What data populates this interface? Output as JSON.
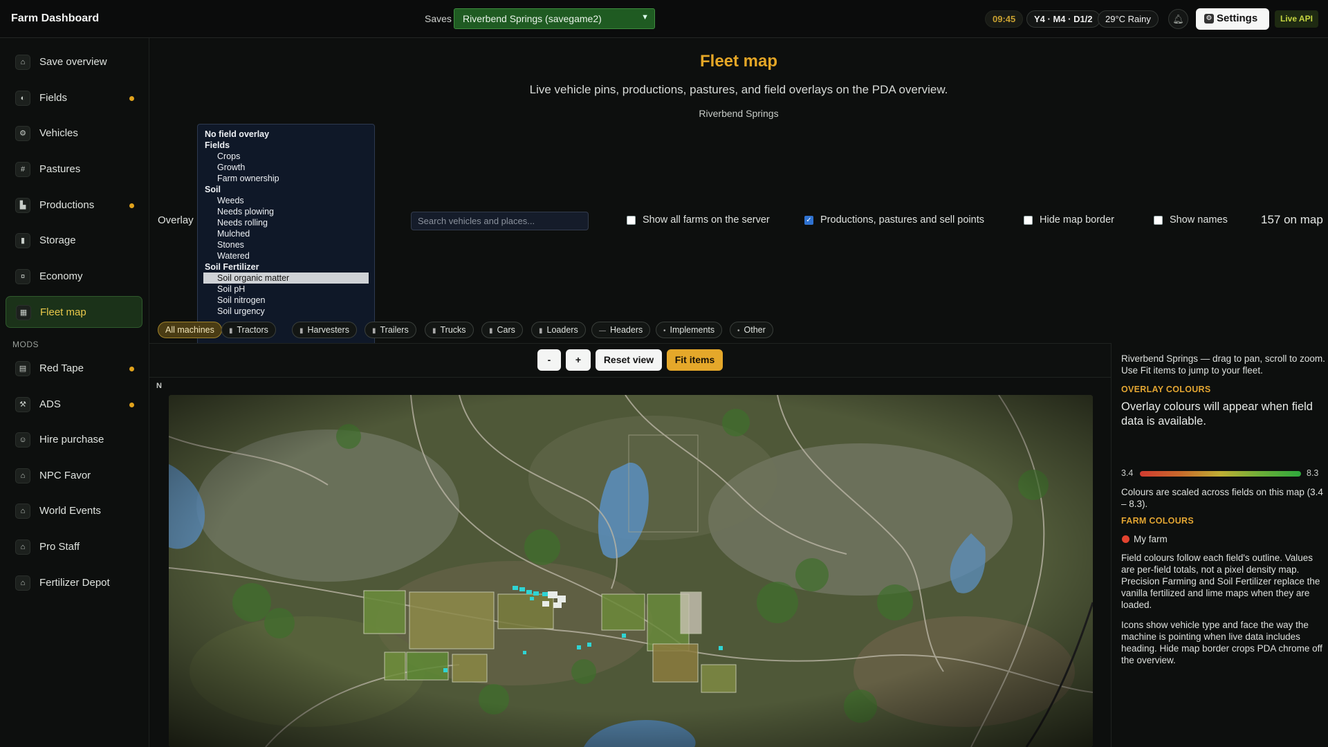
{
  "header": {
    "app_title": "Farm Dashboard",
    "saves_label": "Saves",
    "saves_selected": "Riverbend Springs (savegame2)",
    "time": "09:45",
    "date": "Y4 · M4 · D1/2",
    "weather": "29°C Rainy",
    "settings_label": "Settings",
    "live_api": "Live API"
  },
  "sidebar": {
    "items": [
      {
        "label": "Save overview",
        "icon": "home-icon",
        "dot": false
      },
      {
        "label": "Fields",
        "icon": "fields-icon",
        "dot": true
      },
      {
        "label": "Vehicles",
        "icon": "tractor-icon",
        "dot": false
      },
      {
        "label": "Pastures",
        "icon": "pasture-icon",
        "dot": false
      },
      {
        "label": "Productions",
        "icon": "factory-icon",
        "dot": true
      },
      {
        "label": "Storage",
        "icon": "silo-icon",
        "dot": false
      },
      {
        "label": "Economy",
        "icon": "coins-icon",
        "dot": false
      },
      {
        "label": "Fleet map",
        "icon": "map-icon",
        "dot": false,
        "active": true
      }
    ],
    "mods_label": "MODS",
    "mods": [
      {
        "label": "Red Tape",
        "icon": "clipboard-icon",
        "dot": true
      },
      {
        "label": "ADS",
        "icon": "wrench-icon",
        "dot": true
      },
      {
        "label": "Hire purchase",
        "icon": "person-icon",
        "dot": false
      },
      {
        "label": "NPC Favor",
        "icon": "npc-icon",
        "dot": false
      },
      {
        "label": "World Events",
        "icon": "globe-icon",
        "dot": false
      },
      {
        "label": "Pro Staff",
        "icon": "staff-icon",
        "dot": false
      },
      {
        "label": "Fertilizer Depot",
        "icon": "depot-icon",
        "dot": false
      }
    ]
  },
  "main": {
    "title": "Fleet map",
    "subtitle": "Live vehicle pins, productions, pastures, and field overlays on the PDA overview.",
    "save_name": "Riverbend Springs"
  },
  "controls": {
    "overlay_label": "Overlay",
    "overlay_options": [
      {
        "label": "No field overlay",
        "type": "grp"
      },
      {
        "label": "Fields",
        "type": "grp"
      },
      {
        "label": "Crops",
        "type": "sub"
      },
      {
        "label": "Growth",
        "type": "sub"
      },
      {
        "label": "Farm ownership",
        "type": "sub"
      },
      {
        "label": "Soil",
        "type": "grp"
      },
      {
        "label": "Weeds",
        "type": "sub"
      },
      {
        "label": "Needs plowing",
        "type": "sub"
      },
      {
        "label": "Needs rolling",
        "type": "sub"
      },
      {
        "label": "Mulched",
        "type": "sub"
      },
      {
        "label": "Stones",
        "type": "sub"
      },
      {
        "label": "Watered",
        "type": "sub"
      },
      {
        "label": "Soil Fertilizer",
        "type": "grp"
      },
      {
        "label": "Soil organic matter",
        "type": "sub",
        "selected": true
      },
      {
        "label": "Soil pH",
        "type": "sub"
      },
      {
        "label": "Soil nitrogen",
        "type": "sub"
      },
      {
        "label": "Soil urgency",
        "type": "sub"
      }
    ],
    "search_placeholder": "Search vehicles and places...",
    "show_all_farms": "Show all farms on the server",
    "show_all_farms_checked": false,
    "productions": "Productions, pastures and sell points",
    "productions_checked": true,
    "hide_border": "Hide map border",
    "hide_border_checked": false,
    "show_names": "Show names",
    "show_names_checked": false,
    "count": "157 on map"
  },
  "filters": [
    {
      "label": "All machines",
      "active": true
    },
    {
      "label": "Tractors"
    },
    {
      "label": "Harvesters"
    },
    {
      "label": "Trailers"
    },
    {
      "label": "Trucks"
    },
    {
      "label": "Cars"
    },
    {
      "label": "Loaders"
    },
    {
      "label": "Headers"
    },
    {
      "label": "Implements"
    },
    {
      "label": "Other"
    }
  ],
  "map_toolbar": {
    "zoom_out": "-",
    "zoom_in": "+",
    "reset": "Reset view",
    "fit": "Fit items",
    "north": "N"
  },
  "panel": {
    "hint": "Riverbend Springs — drag to pan, scroll to zoom. Use Fit items to jump to your fleet.",
    "overlay_colours_head": "OVERLAY COLOURS",
    "overlay_colours_text": "Overlay colours will appear when field data is available.",
    "scale_min": "3.4",
    "scale_max": "8.3",
    "scale_note": "Colours are scaled across fields on this map (3.4 – 8.3).",
    "farm_colours_head": "FARM COLOURS",
    "my_farm": "My farm",
    "note1": "Field colours follow each field's outline. Values are per-field totals, not a pixel density map. Precision Farming and Soil Fertilizer replace the vanilla fertilized and lime maps when they are loaded.",
    "note2": "Icons show vehicle type and face the way the machine is pointing when live data includes heading. Hide map border crops PDA chrome off the overview.",
    "colors": {
      "accent": "#e5a82a",
      "farm": "#e2432f",
      "active_nav": "#1b3219"
    }
  }
}
